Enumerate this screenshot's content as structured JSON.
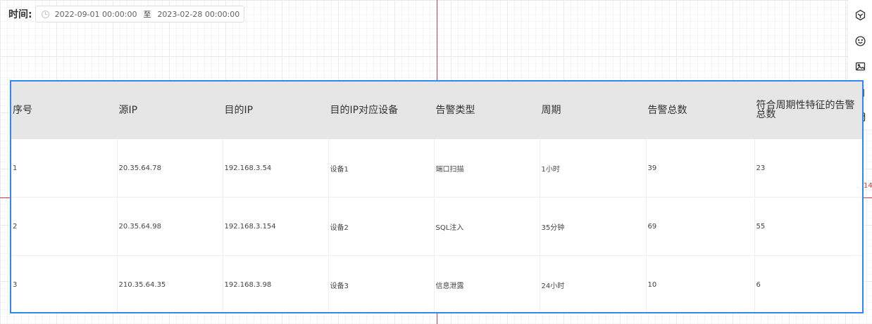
{
  "filter": {
    "label": "时间:",
    "start": "2022-09-01 00:00:00",
    "separator": "至",
    "end": "2023-02-28 00:00:00"
  },
  "guide": {
    "mark": "14"
  },
  "toolbar": {
    "items": [
      {
        "icon": "cube-icon"
      },
      {
        "icon": "smiley-icon"
      },
      {
        "icon": "image-icon"
      },
      {
        "icon": "file-icon"
      },
      {
        "icon": "layout-icon"
      }
    ]
  },
  "table": {
    "headers": [
      "序号",
      "源IP",
      "目的IP",
      "目的IP对应设备",
      "告警类型",
      "周期",
      "告警总数",
      "符合周期性特征的告警总数"
    ],
    "rows": [
      [
        "1",
        "20.35.64.78",
        "192.168.3.54",
        "设备1",
        "端口扫描",
        "1小时",
        "39",
        "23"
      ],
      [
        "2",
        "20.35.64.98",
        "192.168.3.154",
        "设备2",
        "SQL注入",
        "35分钟",
        "69",
        "55"
      ],
      [
        "3",
        "210.35.64.35",
        "192.168.3.98",
        "设备3",
        "信息泄露",
        "24小时",
        "10",
        "6"
      ]
    ]
  }
}
